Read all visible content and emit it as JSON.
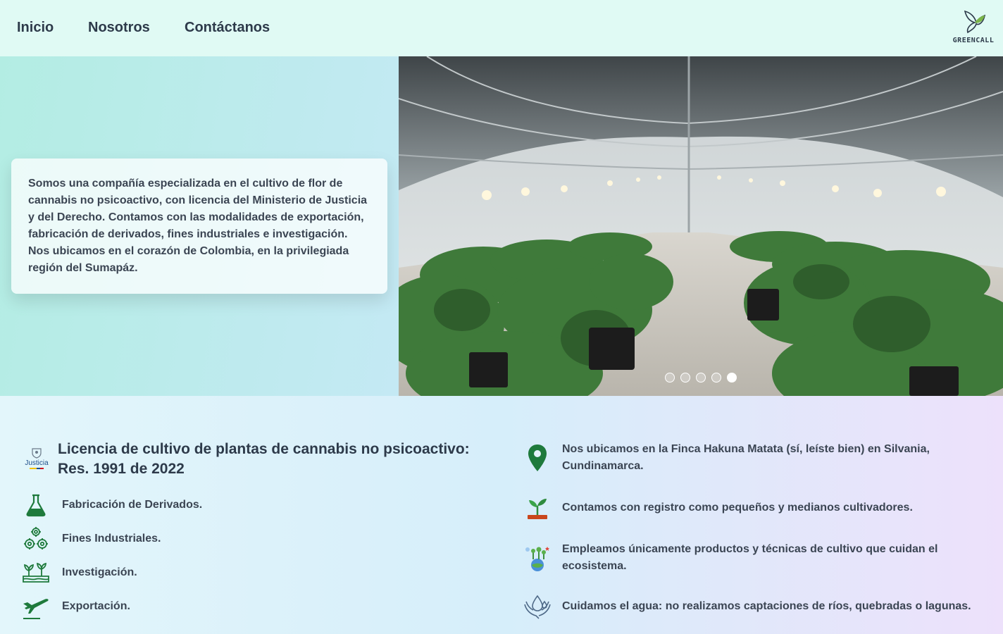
{
  "nav": {
    "links": [
      "Inicio",
      "Nosotros",
      "Contáctanos"
    ],
    "logo_text": "GREENCALL"
  },
  "hero": {
    "intro": "Somos una compañía especializada en el cultivo de flor de cannabis no psicoactivo, con licencia del Ministerio de Justicia y del Derecho. Contamos con las modalidades de exportación, fabricación de derivados, fines industriales e investigación. Nos ubicamos en el corazón de Colombia, en la privilegiada región del Sumapáz.",
    "carousel": {
      "slide_count": 5,
      "active_index": 5,
      "image_icon": "greenhouse-photo"
    }
  },
  "license": {
    "logo_text": "Justicia",
    "title_line1": "Licencia de cultivo de plantas de cannabis no psicoactivo:",
    "title_line2": "Res. 1991 de 2022"
  },
  "modalities": [
    {
      "label": "Fabricación de Derivados.",
      "icon": "flask-icon"
    },
    {
      "label": "Fines Industriales.",
      "icon": "gears-icon"
    },
    {
      "label": "Investigación.",
      "icon": "sprouts-icon"
    },
    {
      "label": "Exportación.",
      "icon": "airplane-icon"
    }
  ],
  "facts": [
    {
      "label": "Nos ubicamos en la Finca Hakuna Matata (sí, leíste bien) en Silvania, Cundinamarca.",
      "icon": "location-pin-icon"
    },
    {
      "label": "Contamos con registro como pequeños y medianos cultivadores.",
      "icon": "seedling-icon"
    },
    {
      "label": "Empleamos únicamente productos y técnicas de cultivo que cuidan el ecosistema.",
      "icon": "ecosystem-icon"
    },
    {
      "label": "Cuidamos el agua: no realizamos captaciones de ríos, quebradas o lagunas.",
      "icon": "water-hands-icon"
    }
  ],
  "colors": {
    "accent_green": "#1e7a3c",
    "nav_bg": "#e0faf4",
    "text": "#2d3a4a"
  }
}
